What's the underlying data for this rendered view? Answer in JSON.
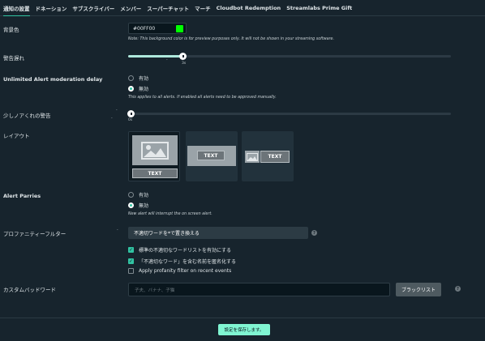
{
  "tabs": [
    {
      "label": "通知の設置",
      "active": true
    },
    {
      "label": "ドネーション"
    },
    {
      "label": "サブスクライバー"
    },
    {
      "label": "メンバー"
    },
    {
      "label": "スーパーチャット"
    },
    {
      "label": "マーチ"
    },
    {
      "label": "Cloudbot Redemption"
    },
    {
      "label": "Streamlabs Prime Gift"
    }
  ],
  "bg_color": {
    "label": "背景色",
    "value": "#00FF00",
    "swatch_color": "#00FF00",
    "note": "Note: This background color is for preview purposes only. It will not be shown in your streaming software."
  },
  "alert_delay": {
    "label": "警告遅れ",
    "value_label": "3s",
    "min_tick": "-",
    "level": 0.17
  },
  "moderation_delay": {
    "label": "Unlimited Alert moderation delay",
    "options": [
      "有効",
      "無効"
    ],
    "selected": "無効",
    "note": "This applies to all alerts. If enabled all alerts need to be approved manually."
  },
  "parry_delay": {
    "label": "少しノアくれの警告",
    "value_label": "0s",
    "min_tick": "-",
    "level": 0.0
  },
  "layout": {
    "label": "レイアウト",
    "text_placeholder": "TEXT",
    "selected_index": 0
  },
  "alert_parries": {
    "label": "Alert Parries",
    "options": [
      "有効",
      "無効"
    ],
    "selected": "無効",
    "note": "New alert will interrupt the on screen alert."
  },
  "profanity": {
    "label": "プロファニティーフルター",
    "select_value": "不適切ワードを*で置き換える",
    "checkboxes": [
      {
        "label": "標準の不適切なワードリストを有効にする",
        "checked": true
      },
      {
        "label": "「不適切なワード」を含む名前を匿名化する",
        "checked": true
      },
      {
        "label": "Apply profanity filter on recent events",
        "checked": false
      }
    ]
  },
  "custom_words": {
    "label": "カスタムバッドワード",
    "placeholder": "子夫、バナナ、子猫",
    "button_label": "ブラックリスト"
  },
  "save_label": "設定を保存します。",
  "help_glyph": "?",
  "check_glyph": "✓"
}
